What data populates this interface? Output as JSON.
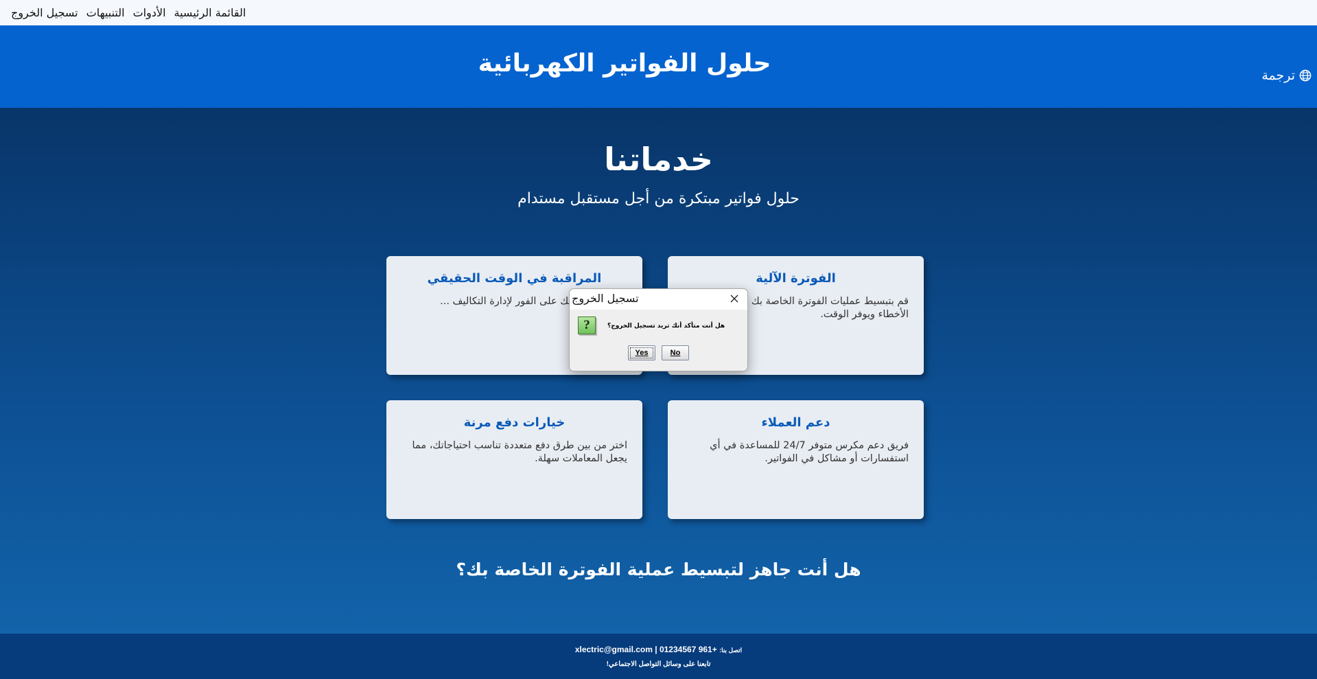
{
  "menubar": {
    "items": [
      "القائمة الرئيسية",
      "الأدوات",
      "التنبيهات",
      "تسجيل الخروج"
    ]
  },
  "header": {
    "title": "حلول الفواتير الكهربائية",
    "translate_label": "ترجمة",
    "translate_icon": "globe-icon"
  },
  "main": {
    "title": "خدماتنا",
    "subtitle": "حلول فواتير مبتكرة من أجل مستقبل مستدام",
    "cards": [
      {
        "title": "الفوترة الآلية",
        "text": "قم بتبسيط عمليات الفوترة الخاصة بك مع ... مما يقلل الأخطاء ويوفر الوقت."
      },
      {
        "title": "المراقبة في الوقت الحقيقي",
        "text": "...اقة الخاص بك على الفور لإدارة التكاليف ... الاستهلاك."
      },
      {
        "title": "دعم العملاء",
        "text": "فريق دعم مكرس متوفر 24/7 للمساعدة في أي استفسارات أو مشاكل في الفواتير."
      },
      {
        "title": "خيارات دفع مرنة",
        "text": "اختر من بين طرق دفع متعددة تناسب احتياجاتك، مما يجعل المعاملات سهلة."
      }
    ],
    "cta": "هل أنت جاهز لتبسيط عملية الفوترة الخاصة بك؟"
  },
  "footer": {
    "contact_label": "اتصل بنا:",
    "contact_value": "+961 01234567 | xlectric@gmail.com",
    "follow_text": "تابعنا على وسائل التواصل الاجتماعي!"
  },
  "dialog": {
    "title": "تسجيل الخروج",
    "message": "هل أنت متأكد أنك تريد تسجيل الخروج؟",
    "icon_glyph": "?",
    "yes_label": "Yes",
    "no_label": "No"
  },
  "colors": {
    "header_bg": "#0563cf",
    "main_bg_top": "#083569",
    "card_bg": "#e8edf3",
    "card_title": "#0a5ab8",
    "footer_bg": "#063b7c"
  }
}
